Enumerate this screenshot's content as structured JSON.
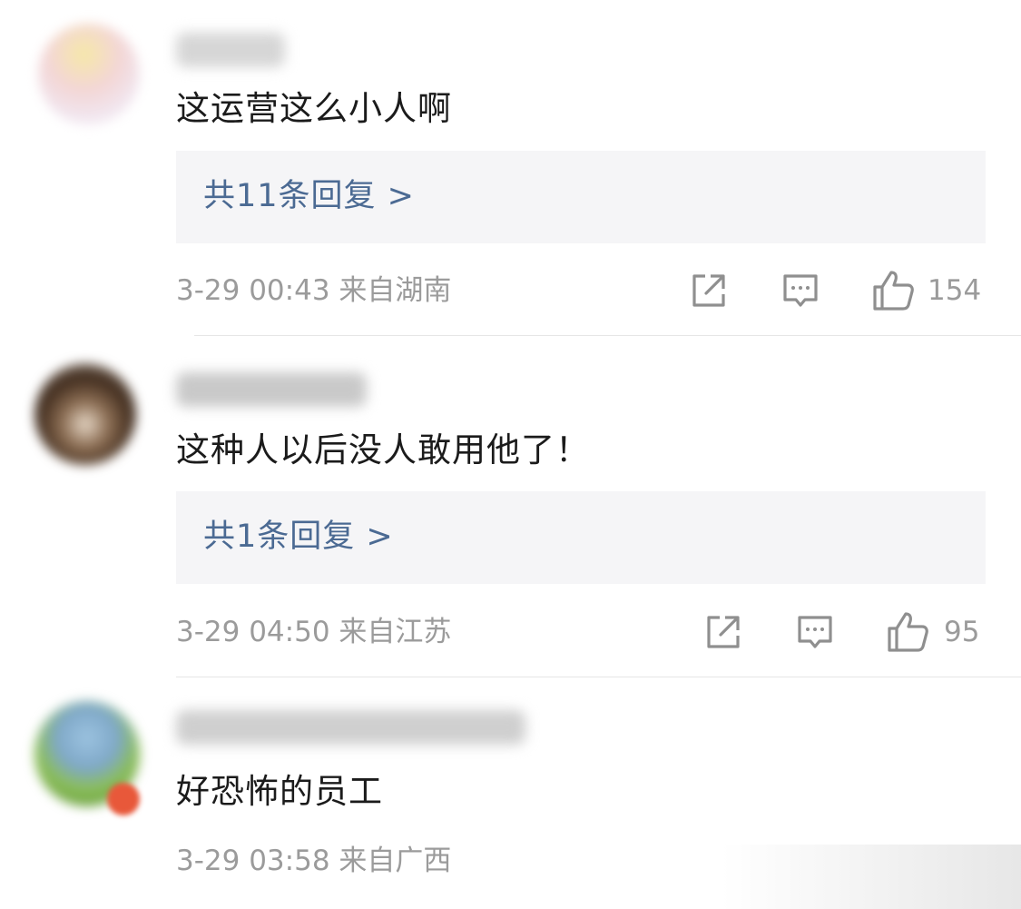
{
  "comments": [
    {
      "content": "这运营这么小人啊",
      "reply_label": "共11条回复 >",
      "meta": "3-29 00:43 来自湖南",
      "likes": "154"
    },
    {
      "content": "这种人以后没人敢用他了！",
      "reply_label": "共1条回复 >",
      "meta": "3-29 04:50 来自江苏",
      "likes": "95"
    },
    {
      "content": "好恐怖的员工",
      "meta": "3-29 03:58 来自广西"
    }
  ],
  "icons": {
    "share": "share-icon",
    "comment": "comment-icon",
    "like": "like-icon"
  },
  "colors": {
    "reply_link": "#4b6a93",
    "meta_text": "#9b9b9b",
    "reply_bg": "#f5f5f7"
  }
}
